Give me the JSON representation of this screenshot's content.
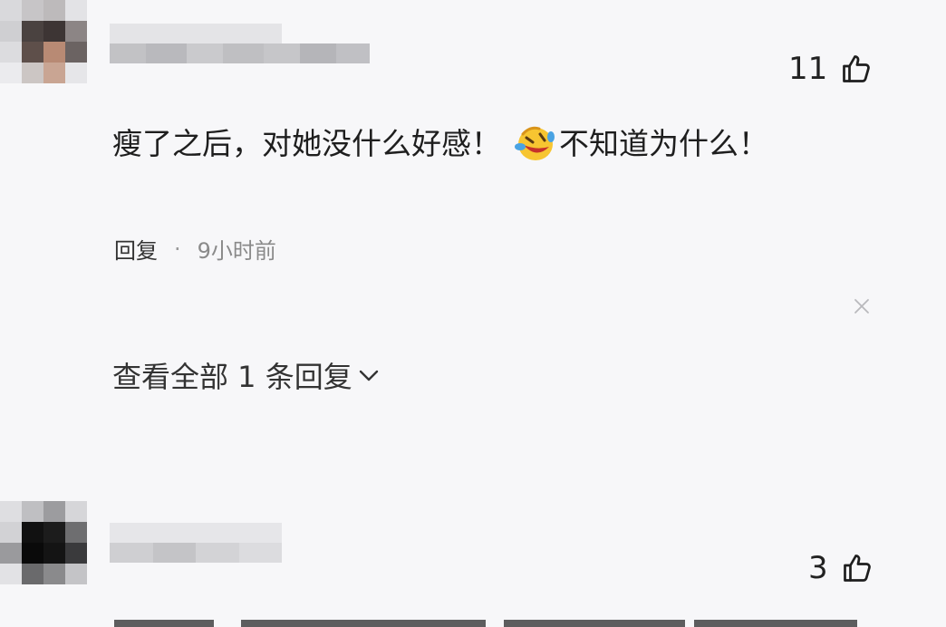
{
  "comments": [
    {
      "likes": "11",
      "text_before_emoji": "瘦了之后，对她没什么好感！",
      "text_after_emoji": "不知道为什么！",
      "emoji": "laughing-crying-emoji",
      "reply_label": "回复",
      "separator": "·",
      "time": "9小时前",
      "view_all_replies": "查看全部 1 条回复"
    },
    {
      "likes": "3"
    }
  ],
  "icons": {
    "like": "thumbs-up-icon",
    "close": "close-icon",
    "expand": "chevron-down-icon"
  },
  "colors": {
    "background": "#f7f7f9",
    "text": "#1e1e1e",
    "muted": "#8a8a8a"
  }
}
